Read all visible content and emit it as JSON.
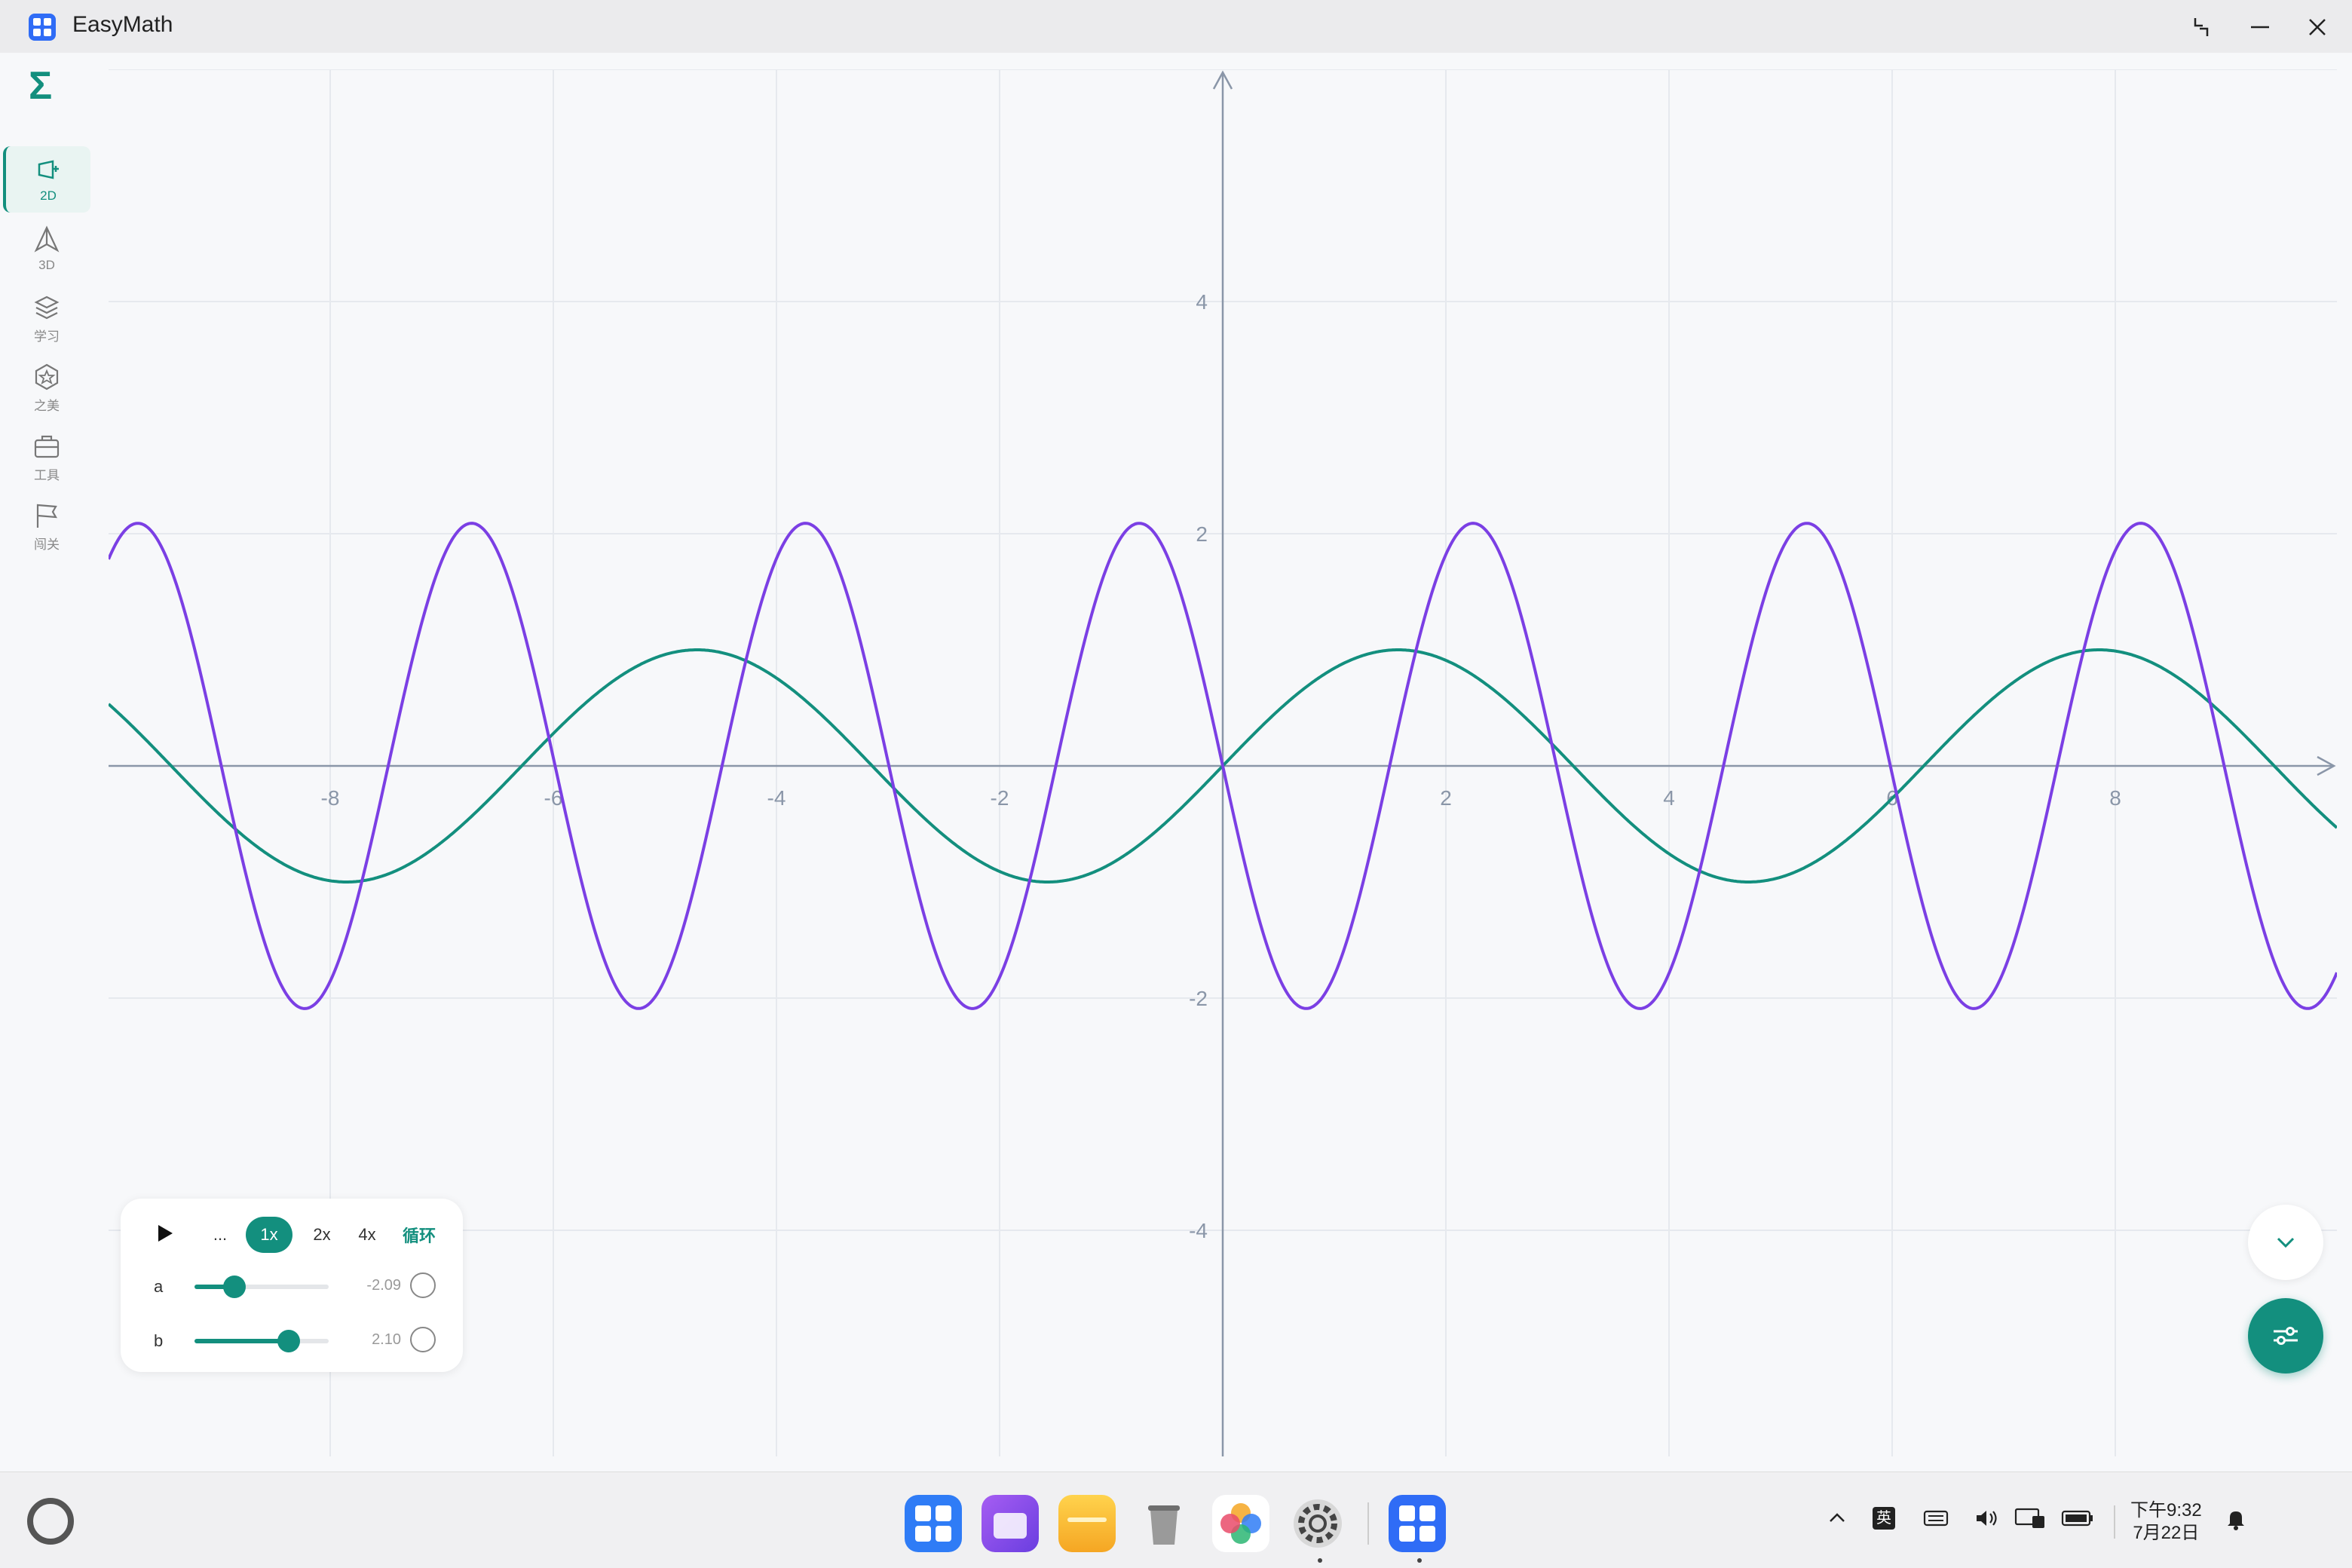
{
  "window": {
    "title": "EasyMath"
  },
  "sidebar": {
    "logo": "Σ",
    "items": [
      {
        "label": "2D",
        "icon": "2d-graph-icon",
        "active": true
      },
      {
        "label": "3D",
        "icon": "3d-pyramid-icon"
      },
      {
        "label": "学习",
        "icon": "layers-icon"
      },
      {
        "label": "之美",
        "icon": "star-hexagon-icon"
      },
      {
        "label": "工具",
        "icon": "toolbox-icon"
      },
      {
        "label": "闯关",
        "icon": "flag-icon"
      }
    ]
  },
  "animation_panel": {
    "ellipsis": "...",
    "speeds": [
      "1x",
      "2x",
      "4x"
    ],
    "selected_speed": "1x",
    "loop_label": "循环",
    "sliders": [
      {
        "name": "a",
        "value": "-2.09",
        "position": 0.3
      },
      {
        "name": "b",
        "value": "2.10",
        "position": 0.7
      }
    ]
  },
  "chart_data": {
    "type": "line",
    "xlim": [
      -10,
      10
    ],
    "ylim": [
      -6,
      6
    ],
    "x_ticks": [
      -8,
      -6,
      -4,
      -2,
      2,
      4,
      6,
      8
    ],
    "x_tick_labels": [
      "-8",
      "-6",
      "-4",
      "-2",
      "2",
      "4",
      "6",
      "8"
    ],
    "y_ticks": [
      4,
      2,
      -2,
      -4
    ],
    "y_tick_labels": [
      "4",
      "2",
      "-2",
      "-4"
    ],
    "grid": true,
    "series": [
      {
        "function": "sin(x)",
        "color": "#138f7e",
        "amplitude": 1,
        "frequency": 1
      },
      {
        "function": "-2.09*sin(2.10*x)",
        "color": "#7b3fe4",
        "amplitude": 2.09,
        "frequency": 2.1,
        "sign": -1
      }
    ]
  },
  "taskbar": {
    "tray": {
      "ime": "英"
    },
    "clock": {
      "time": "下午9:32",
      "date": "7月22日"
    }
  },
  "colors": {
    "accent": "#138f7e",
    "curve2": "#7b3fe4",
    "axis": "#8a96a8"
  }
}
